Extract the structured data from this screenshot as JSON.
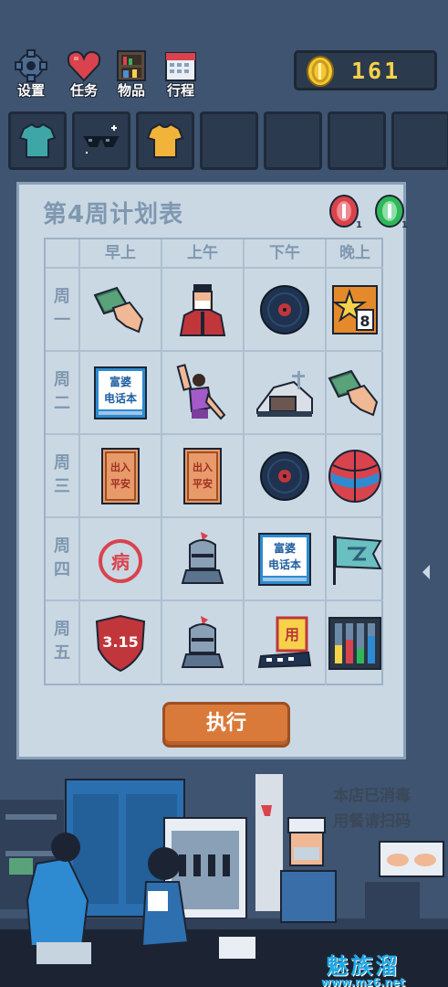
{
  "top_menu": {
    "settings": "设置",
    "tasks": "任务",
    "items": "物品",
    "schedule": "行程"
  },
  "coins": "161",
  "inventory": [
    {
      "icon": "teal-shirt-icon"
    },
    {
      "icon": "sunglasses-icon"
    },
    {
      "icon": "yellow-shirt-icon"
    },
    {
      "icon": ""
    },
    {
      "icon": ""
    },
    {
      "icon": ""
    },
    {
      "icon": ""
    }
  ],
  "plan": {
    "title": "第4周计划表",
    "tokens": [
      {
        "icon": "red-token-icon",
        "count": "1",
        "color": "#d9434d"
      },
      {
        "icon": "green-token-icon",
        "count": "1",
        "color": "#2fb85a"
      }
    ],
    "columns": [
      "早上",
      "上午",
      "下午",
      "晚上"
    ],
    "rows": [
      {
        "day": [
          "周",
          "一"
        ],
        "cells": [
          "money-hand-icon",
          "masked-man-icon",
          "vinyl-record-icon",
          "star-8-card-icon"
        ]
      },
      {
        "day": [
          "周",
          "二"
        ],
        "cells": [
          "phone-book-icon",
          "dancing-woman-icon",
          "mountain-house-icon",
          "money-hand-icon"
        ]
      },
      {
        "day": [
          "周",
          "三"
        ],
        "cells": [
          "safety-charm-icon",
          "safety-charm-icon",
          "vinyl-record-icon",
          "basketball-icon"
        ]
      },
      {
        "day": [
          "周",
          "四"
        ],
        "cells": [
          "sick-stamp-icon",
          "knight-helmet-icon",
          "phone-book-icon",
          "flag-icon"
        ]
      },
      {
        "day": [
          "周",
          "五"
        ],
        "cells": [
          "shield-315-icon",
          "knight-helmet-icon",
          "sign-board-icon",
          "test-tubes-icon"
        ]
      }
    ],
    "small_badge": "8",
    "phone_book": {
      "line1": "富婆",
      "line2": "电话本"
    },
    "charm": {
      "line1": "出入",
      "line2": "平安"
    },
    "sick": "病",
    "shield": "3.15",
    "sign": "用",
    "execute": "执行"
  },
  "scene": {
    "sign_line1": "本店已消毒",
    "sign_line2": "用餐请扫码"
  },
  "watermark": {
    "name": "魅族溜",
    "url": "www.mz6.net"
  }
}
